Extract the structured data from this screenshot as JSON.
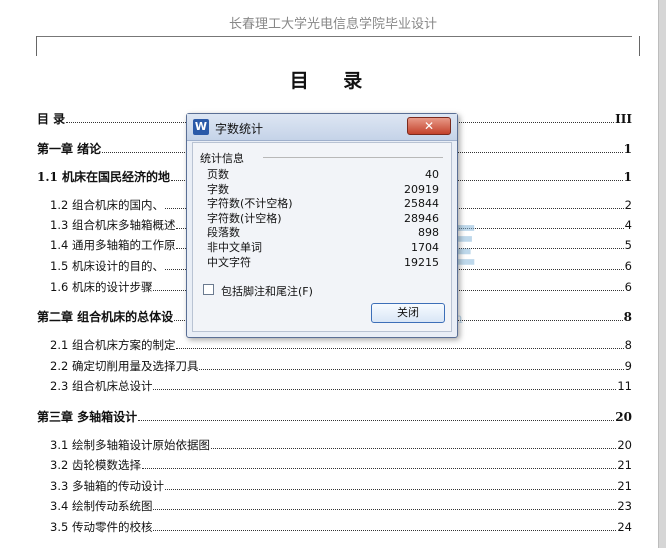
{
  "document": {
    "header_text": "长春理工大学光电信息学院毕业设计",
    "title": "目 录"
  },
  "toc": [
    {
      "label": "目 录",
      "page": "III",
      "bold": true
    },
    {
      "label": "第一章 绪论",
      "page": "1",
      "bold": true
    },
    {
      "label": "1.1 机床在国民经济的地",
      "page": "1",
      "bold": true
    },
    {
      "label": "1.2 组合机床的国内、",
      "page": "2",
      "bold": false
    },
    {
      "label": "1.3 组合机床多轴箱概述",
      "page": "4",
      "bold": false
    },
    {
      "label": "1.4 通用多轴箱的工作原",
      "page": "5",
      "bold": false
    },
    {
      "label": "1.5 机床设计的目的、",
      "page": "6",
      "bold": false
    },
    {
      "label": "1.6 机床的设计步骤",
      "page": "6",
      "bold": false
    },
    {
      "label": "第二章 组合机床的总体设",
      "page": "8",
      "bold": true
    },
    {
      "label": "2.1 组合机床方案的制定",
      "page": "8",
      "bold": false
    },
    {
      "label": "2.2 确定切削用量及选择刀具",
      "page": "9",
      "bold": false
    },
    {
      "label": "2.3 组合机床总设计",
      "page": "11",
      "bold": false
    },
    {
      "label": "第三章 多轴箱设计",
      "page": "20",
      "bold": true
    },
    {
      "label": "3.1 绘制多轴箱设计原始依据图",
      "page": "20",
      "bold": false
    },
    {
      "label": "3.2 齿轮模数选择",
      "page": "21",
      "bold": false
    },
    {
      "label": "3.3 多轴箱的传动设计",
      "page": "21",
      "bold": false
    },
    {
      "label": "3.4 绘制传动系统图",
      "page": "23",
      "bold": false
    },
    {
      "label": "3.5 传动零件的校核",
      "page": "24",
      "bold": false
    }
  ],
  "dialog": {
    "app_icon": "W",
    "title": "字数统计",
    "close_label": "✕",
    "group_label": "统计信息",
    "stats": [
      {
        "label": "页数",
        "value": "40"
      },
      {
        "label": "字数",
        "value": "20919"
      },
      {
        "label": "字符数(不计空格)",
        "value": "25844"
      },
      {
        "label": "字符数(计空格)",
        "value": "28946"
      },
      {
        "label": "段落数",
        "value": "898"
      },
      {
        "label": "非中文单词",
        "value": "1704"
      },
      {
        "label": "中文字符",
        "value": "19215"
      }
    ],
    "checkbox_label": "包括脚注和尾注(F)",
    "checkbox_checked": false,
    "ok_label": "关闭"
  },
  "watermark": {
    "text": "人人文库",
    "url": "www.renrendoc.com"
  },
  "colors": {
    "dialog_bg": "#e9eef6",
    "close_button": "#c3422c",
    "watermark": "#7fb2d8"
  }
}
